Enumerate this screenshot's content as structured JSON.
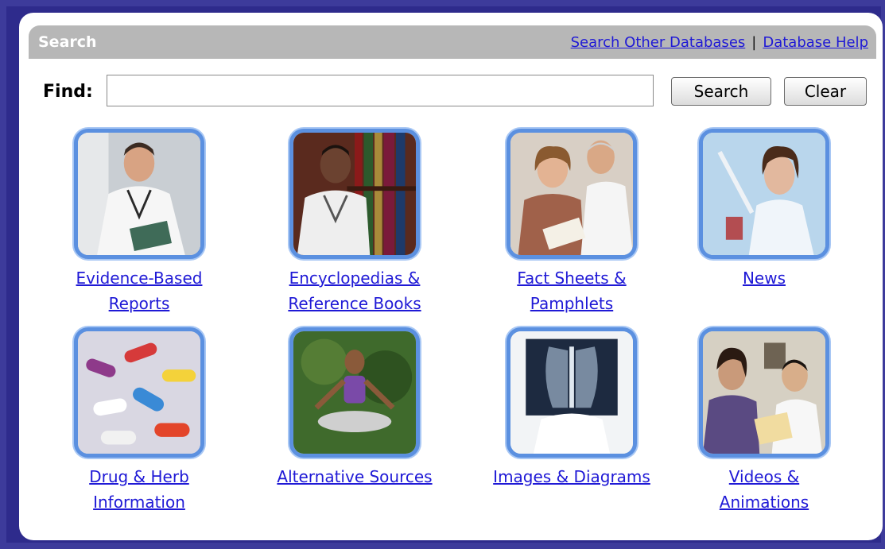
{
  "header": {
    "title": "Search",
    "links": {
      "other_databases": "Search Other Databases",
      "separator": "|",
      "help": "Database Help"
    }
  },
  "find": {
    "label": "Find:",
    "value": "",
    "search_button": "Search",
    "clear_button": "Clear"
  },
  "categories": [
    {
      "line1": "Evidence-Based",
      "line2": "Reports",
      "icon": "doctor-clipboard-photo"
    },
    {
      "line1": "Encyclopedias &",
      "line2": "Reference Books",
      "icon": "doctor-bookshelf-photo"
    },
    {
      "line1": "Fact Sheets &",
      "line2": "Pamphlets",
      "icon": "patient-pamphlet-photo"
    },
    {
      "line1": "News",
      "line2": "",
      "icon": "lab-scientist-photo"
    },
    {
      "line1": "Drug & Herb",
      "line2": "Information",
      "icon": "pills-photo"
    },
    {
      "line1": "Alternative Sources",
      "line2": "",
      "icon": "meditation-photo"
    },
    {
      "line1": "Images & Diagrams",
      "line2": "",
      "icon": "xray-photo"
    },
    {
      "line1": "Videos &",
      "line2": "Animations",
      "icon": "doctor-patient-photo"
    }
  ],
  "colors": {
    "background": "#3d3b9b",
    "header": "#b7b7b7",
    "link": "#1f19d6",
    "thumb_border": "#5b90e0"
  }
}
